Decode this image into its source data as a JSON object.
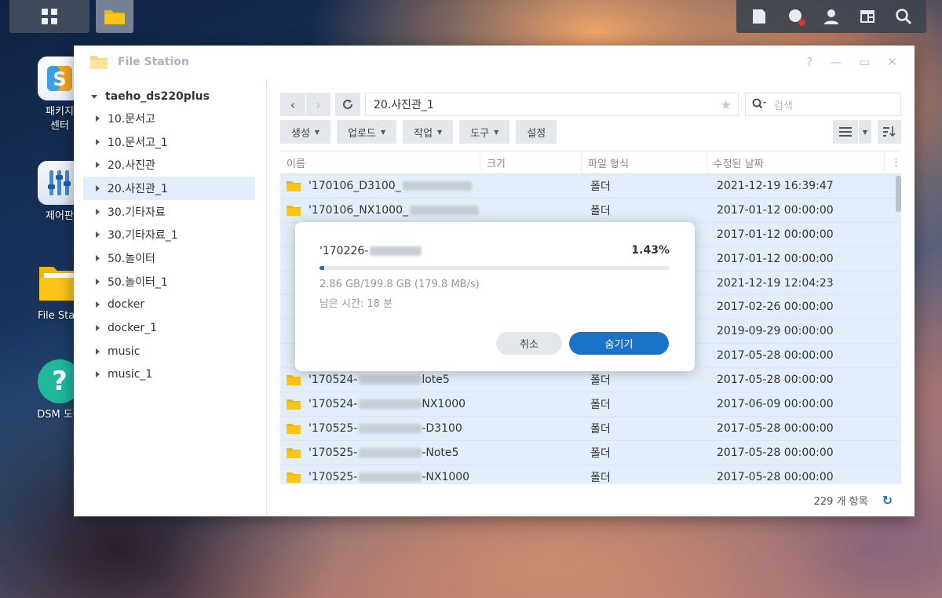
{
  "desktop": {
    "icons": [
      {
        "label": "패키지\n센터",
        "label1": "패키지",
        "label2": "센터"
      },
      {
        "label": "제어판"
      },
      {
        "label": "File Stati"
      },
      {
        "label": "DSM 도움"
      }
    ]
  },
  "window": {
    "title": "File Station",
    "controls": {
      "help": "?",
      "minimize": "—",
      "maximize": "▭",
      "close": "✕"
    }
  },
  "sidebar": {
    "root": "taeho_ds220plus",
    "items": [
      {
        "label": "10.문서고"
      },
      {
        "label": "10.문서고_1"
      },
      {
        "label": "20.사진관"
      },
      {
        "label": "20.사진관_1"
      },
      {
        "label": "30.기타자료"
      },
      {
        "label": "30.기타자료_1"
      },
      {
        "label": "50.놀이터"
      },
      {
        "label": "50.놀이터_1"
      },
      {
        "label": "docker"
      },
      {
        "label": "docker_1"
      },
      {
        "label": "music"
      },
      {
        "label": "music_1"
      }
    ],
    "selected_index": 3
  },
  "toolbar": {
    "path": "20.사진관_1",
    "search_placeholder": "검색",
    "actions": [
      {
        "label": "생성",
        "dropdown": true
      },
      {
        "label": "업로드",
        "dropdown": true
      },
      {
        "label": "작업",
        "dropdown": true
      },
      {
        "label": "도구",
        "dropdown": true
      },
      {
        "label": "설정",
        "dropdown": false
      }
    ]
  },
  "grid": {
    "columns": [
      "이름",
      "크기",
      "파일 형식",
      "수정된 날짜"
    ],
    "rows": [
      {
        "name": "'170106_D3100_",
        "type": "폴더",
        "date": "2021-12-19 16:39:47"
      },
      {
        "name": "'170106_NX1000_",
        "type": "폴더",
        "date": "2017-01-12 00:00:00"
      },
      {
        "name": "",
        "type": "",
        "date": "2017-01-12 00:00:00"
      },
      {
        "name": "",
        "type": "",
        "date": "2017-01-12 00:00:00"
      },
      {
        "name": "",
        "type": "",
        "date": "2021-12-19 12:04:23"
      },
      {
        "name": "",
        "type": "",
        "date": "2017-02-26 00:00:00"
      },
      {
        "name": "",
        "type": "",
        "date": "2019-09-29 00:00:00"
      },
      {
        "name": "",
        "type": "",
        "date": "2017-05-28 00:00:00"
      },
      {
        "name": "'170524-",
        "suffix": "lote5",
        "type": "폴더",
        "date": "2017-05-28 00:00:00"
      },
      {
        "name": "'170524-",
        "suffix": "NX1000",
        "type": "폴더",
        "date": "2017-06-09 00:00:00"
      },
      {
        "name": "'170525-",
        "suffix": "-D3100",
        "type": "폴더",
        "date": "2017-05-28 00:00:00"
      },
      {
        "name": "'170525-",
        "suffix": "-Note5",
        "type": "폴더",
        "date": "2017-05-28 00:00:00"
      },
      {
        "name": "'170525-",
        "suffix": "-NX1000",
        "type": "폴더",
        "date": "2017-05-28 00:00:00"
      }
    ]
  },
  "status": {
    "count": "229 개 항목"
  },
  "dialog": {
    "file": "'170226-",
    "percent": "1.43%",
    "progress_fraction": 0.0143,
    "size": "2.86 GB/199.8 GB (179.8 MB/s)",
    "remaining": "남은 시간: 18 분",
    "cancel": "취소",
    "hide": "숨기기"
  }
}
